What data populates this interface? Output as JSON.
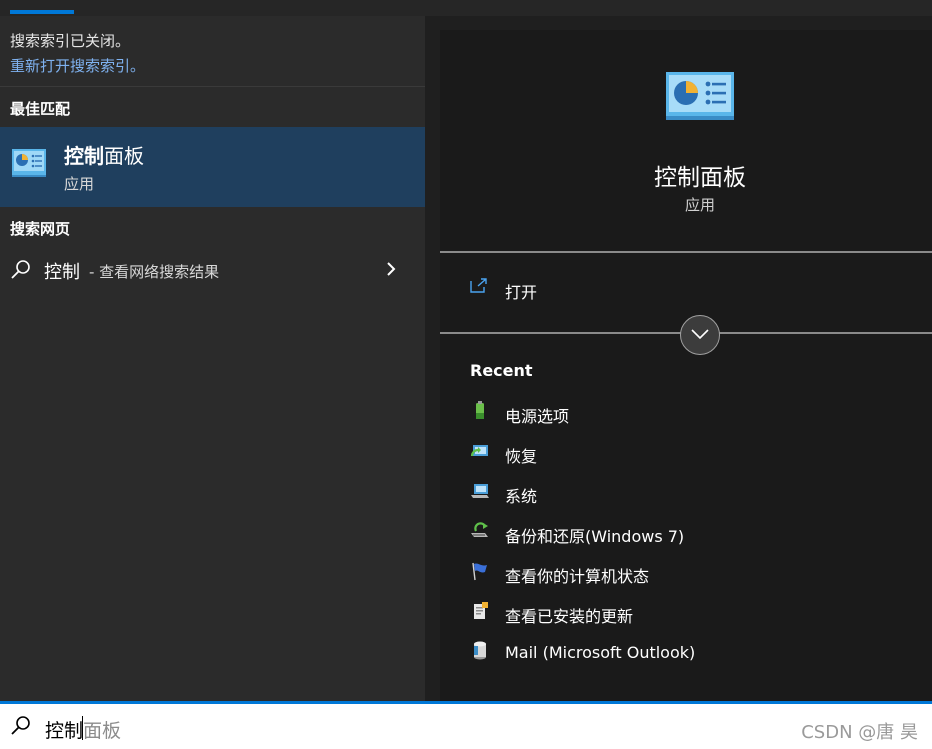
{
  "search_index_notice": {
    "message": "搜索索引已关闭。",
    "link": "重新打开搜索索引。"
  },
  "best_match": {
    "heading": "最佳匹配",
    "title_bold": "控制",
    "title_rest": "面板",
    "subtitle": "应用",
    "icon": "control-panel-icon"
  },
  "web_search": {
    "heading": "搜索网页",
    "term": "控制",
    "suffix": " - 查看网络搜索结果"
  },
  "details": {
    "title": "控制面板",
    "subtitle": "应用",
    "open_label": "打开",
    "recent_heading": "Recent",
    "recent_items": [
      {
        "label": "电源选项",
        "icon": "power-options-icon"
      },
      {
        "label": "恢复",
        "icon": "recovery-icon"
      },
      {
        "label": "系统",
        "icon": "system-icon"
      },
      {
        "label": "备份和还原(Windows 7)",
        "icon": "backup-restore-icon"
      },
      {
        "label": "查看你的计算机状态",
        "icon": "flag-icon"
      },
      {
        "label": "查看已安装的更新",
        "icon": "installed-updates-icon"
      },
      {
        "label": "Mail (Microsoft Outlook)",
        "icon": "mail-icon"
      }
    ]
  },
  "search_box": {
    "typed": "控制",
    "suggestion": "面板",
    "watermark": "CSDN @唐 昊"
  },
  "colors": {
    "accent": "#0078d7",
    "selected_bg": "#1f3f5e",
    "link": "#7fb2f0"
  }
}
